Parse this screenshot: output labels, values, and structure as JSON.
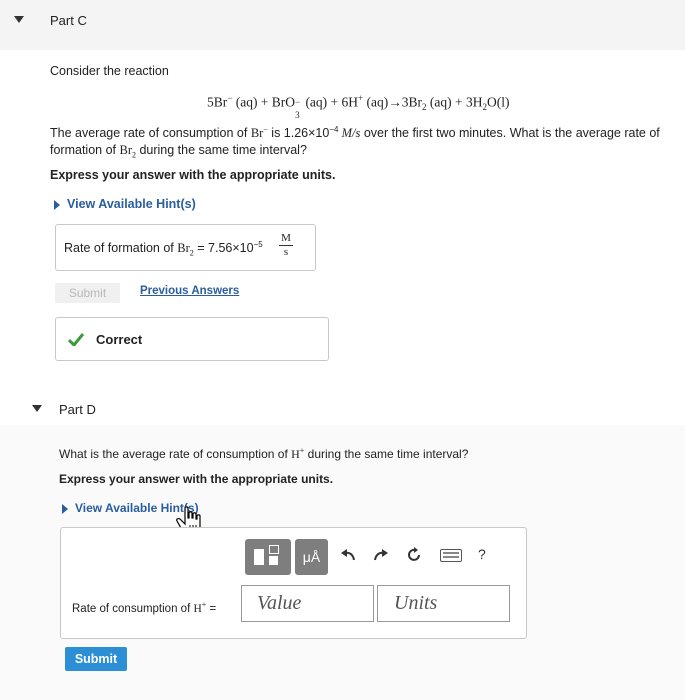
{
  "partC": {
    "title": "Part C",
    "intro": "Consider the reaction",
    "reaction": {
      "br": "5Br",
      "br_sup": "−",
      "br_state": " (aq) + BrO",
      "bro_sub": "3",
      "bro_sup": "−",
      "bro_state": " (aq) + 6H",
      "h_sup": "+",
      "tail1": " (aq)→3Br",
      "br2_sub": "2",
      "tail2": " (aq) + 3H",
      "h2o_sub": "2",
      "tail3": "O(l)"
    },
    "q_line1_a": "The average rate of consumption of ",
    "q_species": "Br",
    "q_species_sup": "−",
    "q_line1_b": " is 1.26×10",
    "q_exp": "−4",
    "q_unit": " M/s",
    "q_line1_c": " over the first two minutes. What is the average rate of",
    "q_line2_a": "formation of ",
    "q_line2_species": "Br",
    "q_line2_sub": "2",
    "q_line2_b": " during the same time interval?",
    "express": "Express your answer with the appropriate units.",
    "hint": "View Available Hint(s)",
    "answer_label_a": "Rate of formation of ",
    "answer_species": "Br",
    "answer_sub": "2",
    "answer_eq": " = ",
    "answer_value": "7.56×10",
    "answer_exp": "−5",
    "answer_num": "M",
    "answer_den": "s",
    "submit": "Submit",
    "previous": "Previous Answers",
    "correct": "Correct"
  },
  "partD": {
    "title": "Part D",
    "question_a": "What is the average rate of consumption of ",
    "question_species": "H",
    "question_sup": "+",
    "question_b": " during the same time interval?",
    "express": "Express your answer with the appropriate units.",
    "hint": "View Available Hint(s)",
    "toolbar_mu": "μÅ",
    "toolbar_help": "?",
    "answer_label_a": "Rate of consumption of ",
    "answer_species": "H",
    "answer_sup": "+",
    "answer_eq": " =",
    "value_placeholder": "Value",
    "units_placeholder": "Units",
    "submit": "Submit"
  },
  "colors": {
    "link": "#2a5d9f",
    "submit": "#2c8fd6",
    "correct": "#3a9b3a"
  }
}
